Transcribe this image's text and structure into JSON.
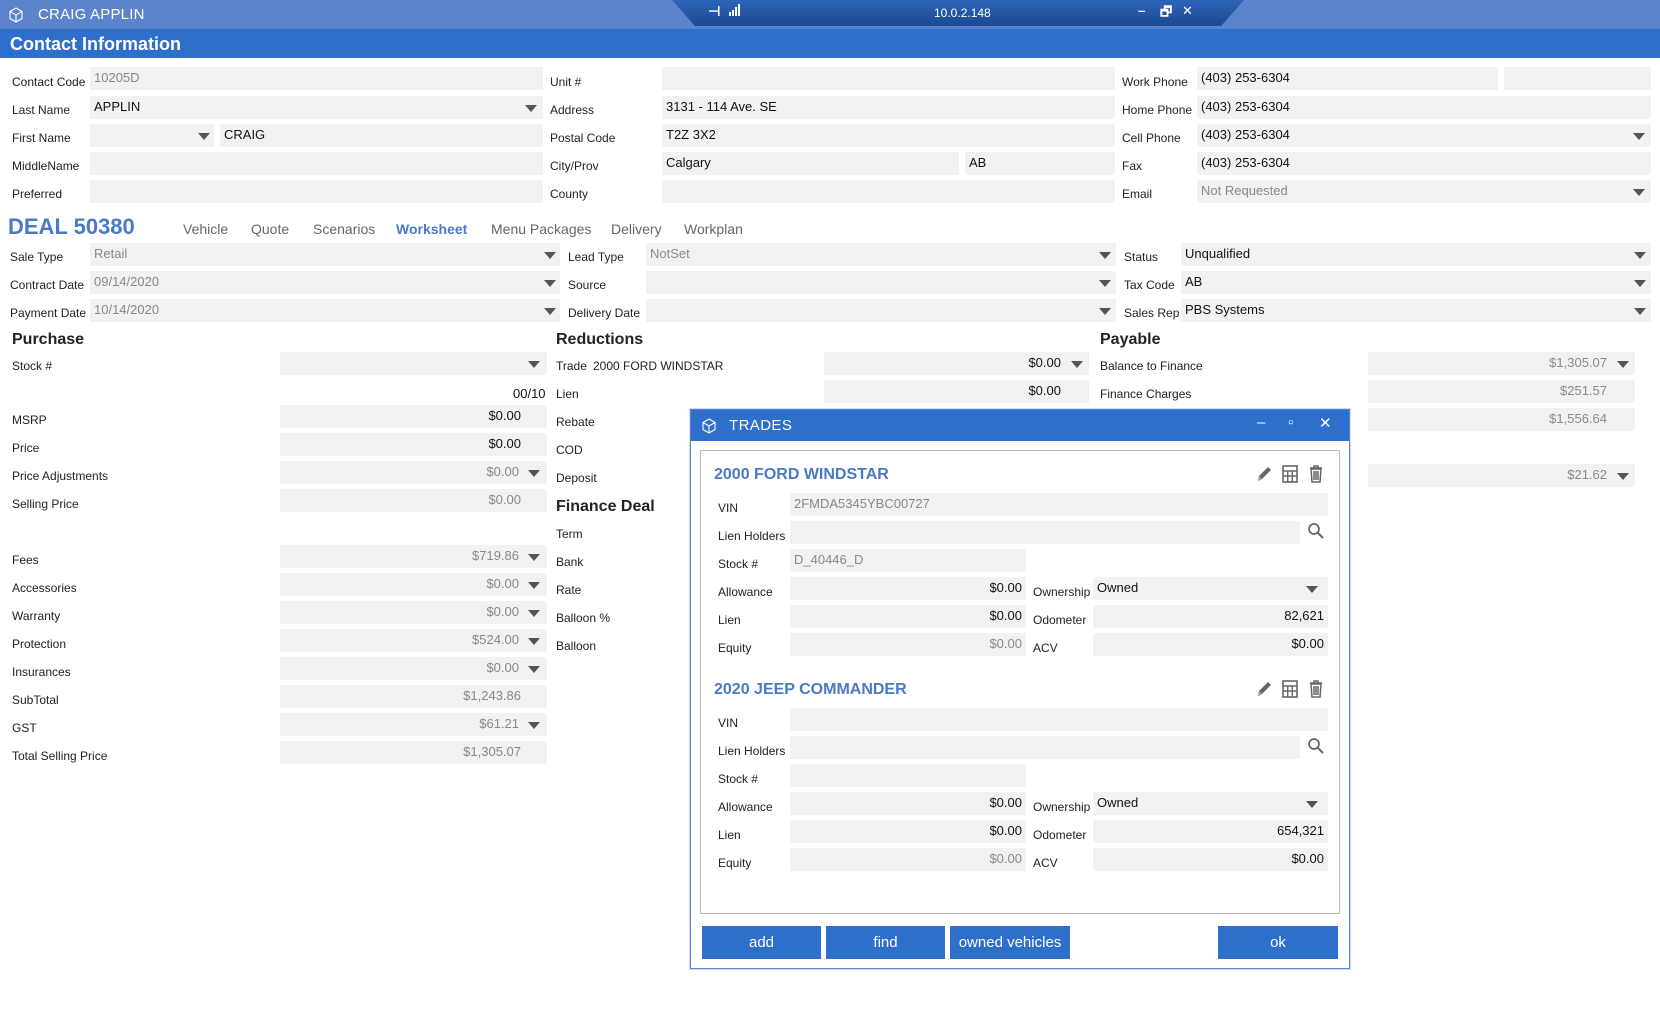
{
  "titlebar": {
    "title": "CRAIG APPLIN",
    "remote_ip": "10.0.2.148",
    "minimize": "–",
    "restore": "🗗",
    "close": "✕"
  },
  "header": {
    "title": "Contact Information"
  },
  "contact": {
    "contact_code_label": "Contact Code",
    "contact_code": "10205D",
    "last_name_label": "Last Name",
    "last_name": "APPLIN",
    "first_name_label": "First Name",
    "first_name_prefix": "",
    "first_name": "CRAIG",
    "middle_name_label": "MiddleName",
    "middle_name": "",
    "preferred_label": "Preferred",
    "preferred": "",
    "unit_label": "Unit #",
    "unit": "",
    "address_label": "Address",
    "address": "3131 - 114 Ave. SE",
    "postal_label": "Postal Code",
    "postal": "T2Z 3X2",
    "city_label": "City/Prov",
    "city": "Calgary",
    "prov": "AB",
    "county_label": "County",
    "county": "",
    "work_phone_label": "Work Phone",
    "work_phone": "(403) 253-6304",
    "work_ext": "",
    "home_phone_label": "Home Phone",
    "home_phone": "(403) 253-6304",
    "cell_phone_label": "Cell Phone",
    "cell_phone": "(403) 253-6304",
    "fax_label": "Fax",
    "fax": "(403) 253-6304",
    "email_label": "Email",
    "email": "Not Requested"
  },
  "deal": {
    "title": "DEAL 50380",
    "tabs": [
      {
        "label": "Vehicle"
      },
      {
        "label": "Quote"
      },
      {
        "label": "Scenarios"
      },
      {
        "label": "Worksheet"
      },
      {
        "label": "Menu Packages"
      },
      {
        "label": "Delivery"
      },
      {
        "label": "Workplan"
      }
    ],
    "sale_type_label": "Sale Type",
    "sale_type": "Retail",
    "contract_date_label": "Contract Date",
    "contract_date": "09/14/2020",
    "payment_date_label": "Payment Date",
    "payment_date": "10/14/2020",
    "lead_type_label": "Lead Type",
    "lead_type": "NotSet",
    "source_label": "Source",
    "source": "",
    "delivery_date_label": "Delivery Date",
    "delivery_date": "",
    "status_label": "Status",
    "status": "Unqualified",
    "tax_code_label": "Tax Code",
    "tax_code": "AB",
    "sales_rep_label": "Sales Rep",
    "sales_rep": "PBS Systems"
  },
  "purchase": {
    "title": "Purchase",
    "stock_label": "Stock #",
    "stock": "",
    "odo_code": "00/10",
    "msrp_label": "MSRP",
    "msrp": "$0.00",
    "price_label": "Price",
    "price": "$0.00",
    "price_adj_label": "Price Adjustments",
    "price_adj": "$0.00",
    "selling_price_label": "Selling Price",
    "selling_price": "$0.00",
    "fees_label": "Fees",
    "fees": "$719.86",
    "accessories_label": "Accessories",
    "accessories": "$0.00",
    "warranty_label": "Warranty",
    "warranty": "$0.00",
    "protection_label": "Protection",
    "protection": "$524.00",
    "insurances_label": "Insurances",
    "insurances": "$0.00",
    "subtotal_label": "SubTotal",
    "subtotal": "$1,243.86",
    "gst_label": "GST",
    "gst": "$61.21",
    "total_label": "Total Selling Price",
    "total": "$1,305.07"
  },
  "reductions": {
    "title": "Reductions",
    "trade_label": "Trade",
    "trade_vehicle": "2000 FORD WINDSTAR",
    "trade": "$0.00",
    "lien_label": "Lien",
    "lien": "$0.00",
    "rebate_label": "Rebate",
    "cod_label": "COD",
    "deposit_label": "Deposit"
  },
  "finance": {
    "title": "Finance Deal",
    "term_label": "Term",
    "bank_label": "Bank",
    "rate_label": "Rate",
    "balloon_pct_label": "Balloon %",
    "balloon_label": "Balloon"
  },
  "payable": {
    "title": "Payable",
    "balance_label": "Balance to Finance",
    "balance": "$1,305.07",
    "charges_label": "Finance Charges",
    "charges": "$251.57",
    "total": "$1,556.64",
    "payment": "$21.62"
  },
  "trades_dialog": {
    "title": "TRADES",
    "trades": [
      {
        "name": "2000 FORD WINDSTAR",
        "vin_label": "VIN",
        "vin": "2FMDA5345YBC00727",
        "lien_holders_label": "Lien Holders",
        "lien_holders": "",
        "stock_label": "Stock #",
        "stock": "D_40446_D",
        "allowance_label": "Allowance",
        "allowance": "$0.00",
        "lien_label": "Lien",
        "lien": "$0.00",
        "equity_label": "Equity",
        "equity": "$0.00",
        "ownership_label": "Ownership",
        "ownership": "Owned",
        "odometer_label": "Odometer",
        "odometer": "82,621",
        "acv_label": "ACV",
        "acv": "$0.00"
      },
      {
        "name": "2020 JEEP COMMANDER",
        "vin_label": "VIN",
        "vin": "",
        "lien_holders_label": "Lien Holders",
        "lien_holders": "",
        "stock_label": "Stock #",
        "stock": "",
        "allowance_label": "Allowance",
        "allowance": "$0.00",
        "lien_label": "Lien",
        "lien": "$0.00",
        "equity_label": "Equity",
        "equity": "$0.00",
        "ownership_label": "Ownership",
        "ownership": "Owned",
        "odometer_label": "Odometer",
        "odometer": "654,321",
        "acv_label": "ACV",
        "acv": "$0.00"
      }
    ],
    "buttons": {
      "add": "add",
      "find": "find",
      "owned": "owned vehicles",
      "ok": "ok"
    }
  },
  "colors": {
    "accent": "#2e6fcc",
    "titlebar": "#5b84cc",
    "deal_title": "#4a79c5",
    "field_bg": "#f2f2f2"
  },
  "icons": [
    "cube-icon",
    "pin-icon",
    "signal-icon",
    "pencil-icon",
    "calculator-icon",
    "trash-icon",
    "search-icon",
    "chevron-down-icon"
  ]
}
